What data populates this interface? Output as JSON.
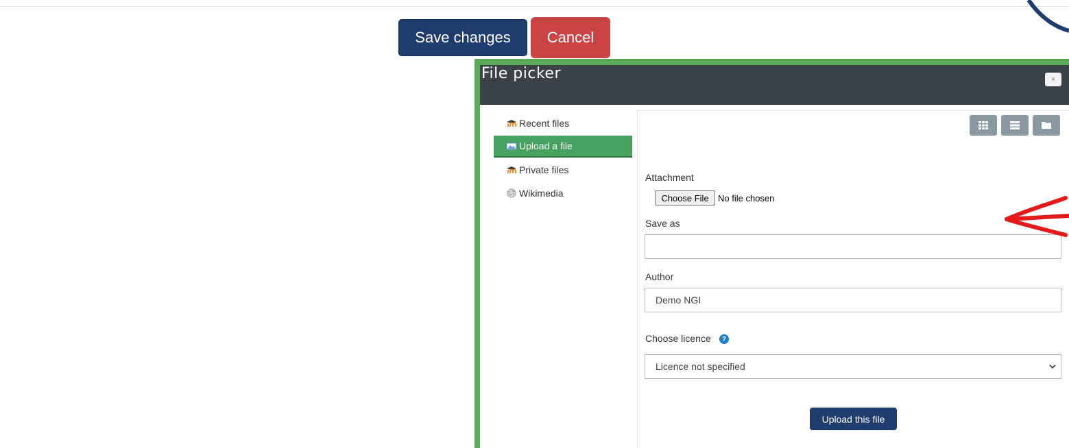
{
  "form_actions": {
    "save_label": "Save changes",
    "cancel_label": "Cancel"
  },
  "file_picker": {
    "title": "File picker",
    "close_glyph": "×",
    "repositories": [
      {
        "label": "Recent files",
        "icon": "moodle-icon",
        "active": false
      },
      {
        "label": "Upload a file",
        "icon": "upload-icon",
        "active": true
      },
      {
        "label": "Private files",
        "icon": "moodle-icon",
        "active": false
      },
      {
        "label": "Wikimedia",
        "icon": "wikimedia-icon",
        "active": false
      }
    ],
    "view_modes": [
      "grid-view-icon",
      "list-view-icon",
      "folder-view-icon"
    ],
    "upload_form": {
      "attachment_label": "Attachment",
      "choose_file_label": "Choose File",
      "file_status": "No file chosen",
      "save_as_label": "Save as",
      "save_as_value": "",
      "author_label": "Author",
      "author_value": "Demo NGI",
      "licence_label": "Choose licence",
      "licence_selected": "Licence not specified",
      "upload_button_label": "Upload this file"
    }
  },
  "colors": {
    "primary": "#1f3c6e",
    "danger": "#cb4444",
    "frame_highlight": "#5aaa5a",
    "active_repo": "#47a15f",
    "header_dark": "#3b4248",
    "annotation_arrow": "#e51b1b"
  }
}
